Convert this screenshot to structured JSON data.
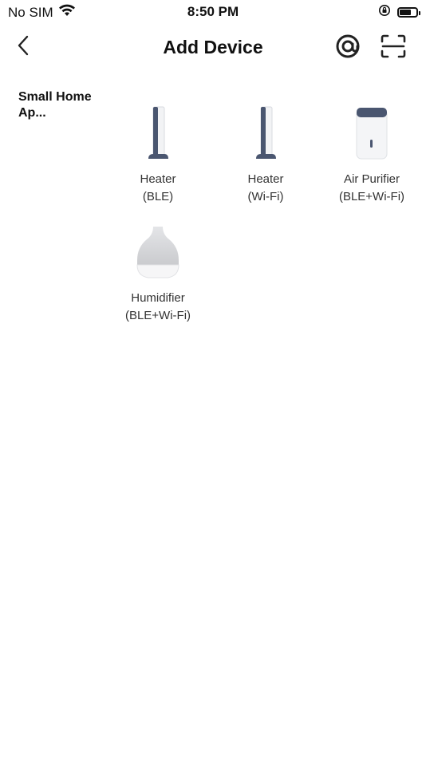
{
  "status_bar": {
    "carrier": "No SIM",
    "time": "8:50 PM"
  },
  "nav": {
    "title": "Add Device",
    "back_icon": "chevron-left-icon",
    "at_icon": "at-sign-icon",
    "scan_icon": "scan-icon"
  },
  "category": {
    "label": "Small Home Ap..."
  },
  "devices": [
    {
      "name": "Heater",
      "protocol": "(BLE)",
      "icon": "tower-heater-icon"
    },
    {
      "name": "Heater",
      "protocol": "(Wi-Fi)",
      "icon": "tower-heater-icon"
    },
    {
      "name": "Air Purifier",
      "protocol": "(BLE+Wi-Fi)",
      "icon": "air-purifier-icon"
    },
    {
      "name": "Humidifier",
      "protocol": "(BLE+Wi-Fi)",
      "icon": "humidifier-icon"
    }
  ]
}
